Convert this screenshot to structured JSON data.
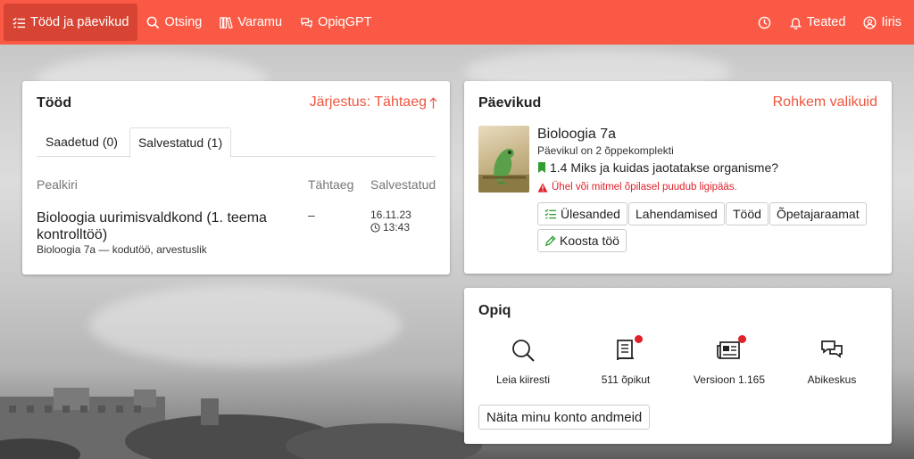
{
  "nav": {
    "works_label": "Tööd ja päevikud",
    "search_label": "Otsing",
    "library_label": "Varamu",
    "gpt_label": "OpiqGPT",
    "notifications_label": "Teated",
    "user_label": "Iiris"
  },
  "works": {
    "title": "Tööd",
    "sort_link": "Järjestus: Tähtaeg",
    "tabs": [
      "Saadetud (0)",
      "Salvestatud (1)"
    ],
    "active_tab": 1,
    "columns": {
      "title": "Pealkiri",
      "deadline": "Tähtaeg",
      "saved": "Salvestatud"
    },
    "items": [
      {
        "title": "Bioloogia uurimisvaldkond (1. teema kontrolltöö)",
        "subtitle": "Bioloogia 7a — kodutöö, arvestuslik",
        "deadline": "–",
        "saved_date": "16.11.23",
        "saved_time": "13:43"
      }
    ]
  },
  "diaries": {
    "title": "Päevikud",
    "more_link": "Rohkem valikuid",
    "book": {
      "title": "Bioloogia 7a",
      "subtitle": "Päevikul on 2 õppekomplekti",
      "chapter": "1.4 Miks ja kuidas jaotatakse organisme?",
      "warning": "Ühel või mitmel õpilasel puudub ligipääs."
    },
    "buttons": {
      "tasks": "Ülesanded",
      "solutions": "Lahendamised",
      "works": "Tööd",
      "teacher_book": "Õpetajaraamat",
      "compose": "Koosta töö"
    }
  },
  "opiq": {
    "title": "Opiq",
    "items": [
      {
        "label": "Leia kiiresti",
        "icon": "search-icon",
        "dot": false
      },
      {
        "label": "511 õpikut",
        "icon": "book-icon",
        "dot": true
      },
      {
        "label": "Versioon 1.165",
        "icon": "newspaper-icon",
        "dot": true
      },
      {
        "label": "Abikeskus",
        "icon": "chat-icon",
        "dot": false
      }
    ],
    "account_button": "Näita minu konto andmeid"
  },
  "colors": {
    "brand": "#fa5a45",
    "brand_dark": "#d84433",
    "link": "#f0553f",
    "warning": "#e0212b",
    "success": "#2e9e2e"
  }
}
